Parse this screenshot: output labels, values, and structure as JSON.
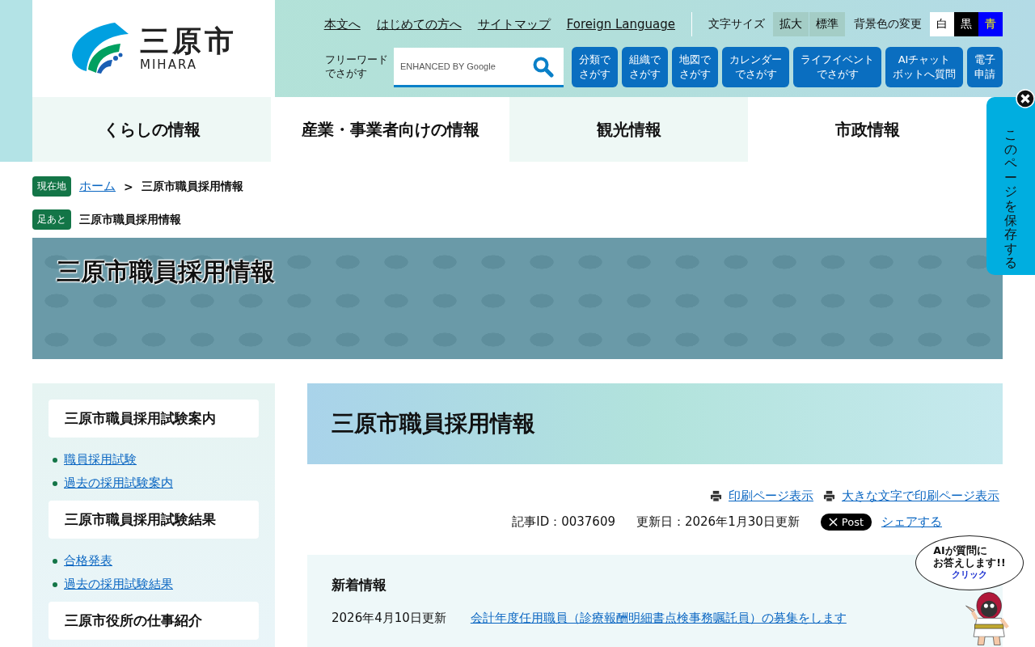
{
  "header": {
    "logo": {
      "name": "三原市",
      "roman": "MIHARA"
    },
    "top_links": [
      "本文へ",
      "はじめての方へ",
      "サイトマップ",
      "Foreign Language"
    ],
    "font_size": {
      "label": "文字サイズ",
      "buttons": [
        "拡大",
        "標準"
      ]
    },
    "bg_color": {
      "label": "背景色の変更",
      "options": [
        {
          "label": "白",
          "color": "#ffffff"
        },
        {
          "label": "黒",
          "color": "#000000"
        },
        {
          "label": "青",
          "color": "#0000ff"
        }
      ]
    },
    "search": {
      "label_lines": [
        "フリーワード",
        "でさがす"
      ],
      "placeholder": "ENHANCED BY Google"
    },
    "finders": [
      {
        "lines": [
          "分類で",
          "さがす"
        ]
      },
      {
        "lines": [
          "組織で",
          "さがす"
        ]
      },
      {
        "lines": [
          "地図で",
          "さがす"
        ]
      },
      {
        "lines": [
          "カレンダー",
          "でさがす"
        ]
      },
      {
        "lines": [
          "ライフイベント",
          "でさがす"
        ]
      },
      {
        "lines": [
          "AIチャット",
          "ボットへ質問"
        ]
      },
      {
        "lines": [
          "電子",
          "申請"
        ]
      }
    ]
  },
  "nav": [
    "くらしの情報",
    "産業・事業者向けの情報",
    "観光情報",
    "市政情報"
  ],
  "breadcrumb": {
    "badge": "現在地",
    "home": "ホーム",
    "separator": ">",
    "current": "三原市職員採用情報"
  },
  "footprint": {
    "badge": "足あと",
    "items": [
      "三原市職員採用情報"
    ]
  },
  "banner": {
    "title": "三原市職員採用情報"
  },
  "sidebar": [
    {
      "heading": "三原市職員採用試験案内",
      "links": [
        "職員採用試験",
        "過去の採用試験案内"
      ]
    },
    {
      "heading": "三原市職員採用試験結果",
      "links": [
        "合格発表",
        "過去の採用試験結果"
      ]
    },
    {
      "heading": "三原市役所の仕事紹介"
    }
  ],
  "article": {
    "title": "三原市職員採用情報",
    "print_links": [
      "印刷ページ表示",
      "大きな文字で印刷ページ表示"
    ],
    "article_id": "記事ID：0037609",
    "updated": "更新日：2026年1月30日更新",
    "post_button": "Post",
    "share": "シェアする"
  },
  "news": {
    "heading": "新着情報",
    "items": [
      {
        "date": "2026年4月10日更新",
        "title": "会計年度任用職員（診療報酬明細書点検事務嘱託員）の募集をします"
      }
    ]
  },
  "save_tab": {
    "label": "このページを保存する"
  },
  "mascot": {
    "balloon_lines": [
      "AIが質問に",
      "お答えします!!"
    ],
    "link": "クリック"
  }
}
